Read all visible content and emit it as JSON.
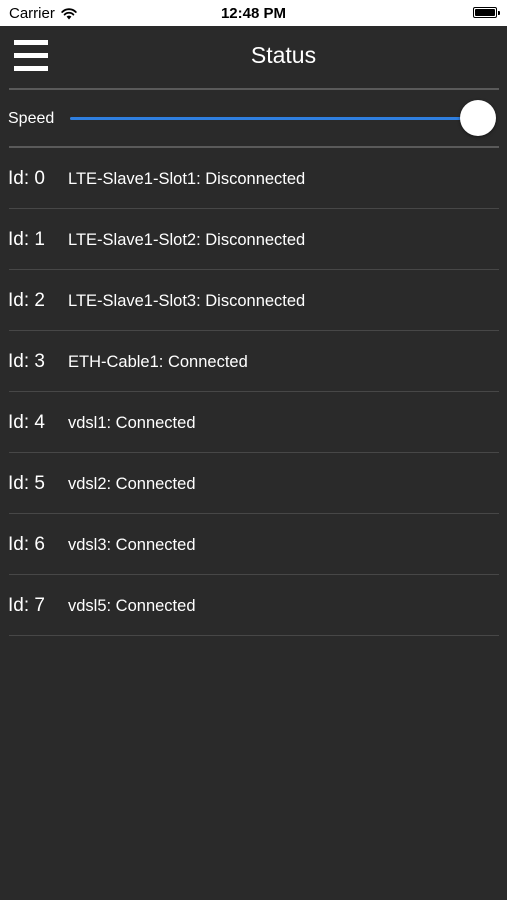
{
  "status_bar": {
    "carrier": "Carrier",
    "time": "12:48 PM",
    "wifi_icon": "wifi-icon",
    "battery_icon": "battery-icon"
  },
  "header": {
    "menu_icon": "hamburger-menu-icon",
    "title": "Status"
  },
  "speed": {
    "label": "Speed",
    "value_fraction": 1.0,
    "accent_color": "#2f7fe0"
  },
  "items": [
    {
      "id": "Id: 0",
      "text": "LTE-Slave1-Slot1: Disconnected"
    },
    {
      "id": "Id: 1",
      "text": "LTE-Slave1-Slot2: Disconnected"
    },
    {
      "id": "Id: 2",
      "text": "LTE-Slave1-Slot3: Disconnected"
    },
    {
      "id": "Id: 3",
      "text": "ETH-Cable1: Connected"
    },
    {
      "id": "Id: 4",
      "text": "vdsl1: Connected"
    },
    {
      "id": "Id: 5",
      "text": "vdsl2: Connected"
    },
    {
      "id": "Id: 6",
      "text": "vdsl3: Connected"
    },
    {
      "id": "Id: 7",
      "text": "vdsl5: Connected"
    }
  ],
  "colors": {
    "background": "#2a2a2a",
    "text": "#ffffff"
  }
}
